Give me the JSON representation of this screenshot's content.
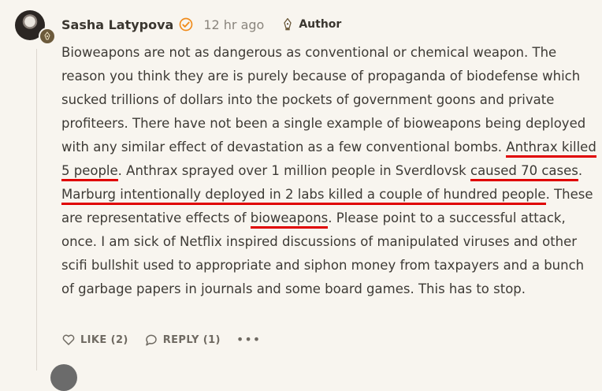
{
  "comment": {
    "author": "Sasha Latypova",
    "time": "12 hr ago",
    "author_badge": "Author",
    "paragraph": [
      {
        "text": "Bioweapons are not as dangerous as conventional or chemical weapon. The reason you think they are is purely because of propaganda of biodefense which sucked trillions of dollars into the pockets of government goons and private profiteers. There have not been a single example of bioweapons being deployed with any similar effect of devastation as a few conventional bombs. ",
        "underline": false
      },
      {
        "text": "Anthrax killed 5 people",
        "underline": true
      },
      {
        "text": ". Anthrax sprayed over 1 million people in Sverdlovsk ",
        "underline": false
      },
      {
        "text": "caused 70 cases",
        "underline": true
      },
      {
        "text": ". ",
        "underline": false
      },
      {
        "text": "Marburg intentionally deployed in 2 labs killed a couple of hundred people",
        "underline": true
      },
      {
        "text": ". These are representative effects of ",
        "underline": false
      },
      {
        "text": "bioweapons",
        "underline": true
      },
      {
        "text": ". Please point to a successful attack, once. I am sick of Netflix inspired discussions of manipulated viruses and other scifi bullshit used to appropriate and siphon money from taxpayers and a bunch of garbage papers in journals and some board games. This has to stop.",
        "underline": false
      }
    ],
    "highlight_color": "#e00000",
    "actions": {
      "like_label": "LIKE (2)",
      "reply_label": "REPLY (1)",
      "more_label": "•••"
    },
    "icons": {
      "verified": "verified-check-icon",
      "author_badge": "fountain-pen-icon",
      "like": "heart-icon",
      "reply": "speech-bubble-icon",
      "more": "ellipsis-icon"
    }
  }
}
